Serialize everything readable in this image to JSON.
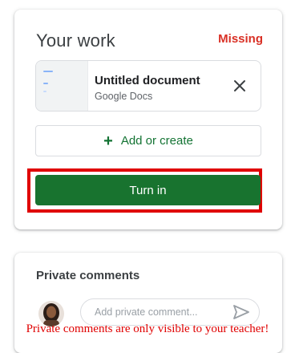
{
  "work": {
    "title": "Your work",
    "status": "Missing",
    "attachment": {
      "name": "Untitled document",
      "type": "Google Docs",
      "remove_icon": "close-icon"
    },
    "add_label": "Add or create",
    "add_icon": "plus-icon",
    "turn_in_label": "Turn in"
  },
  "comments": {
    "title": "Private comments",
    "placeholder": "Add private comment...",
    "send_icon": "send-icon"
  },
  "notice": "Private comments are only visible to your teacher!",
  "colors": {
    "missing": "#d93025",
    "accent_green": "#137333",
    "button_green": "#18732f",
    "highlight_red": "#e00000"
  }
}
